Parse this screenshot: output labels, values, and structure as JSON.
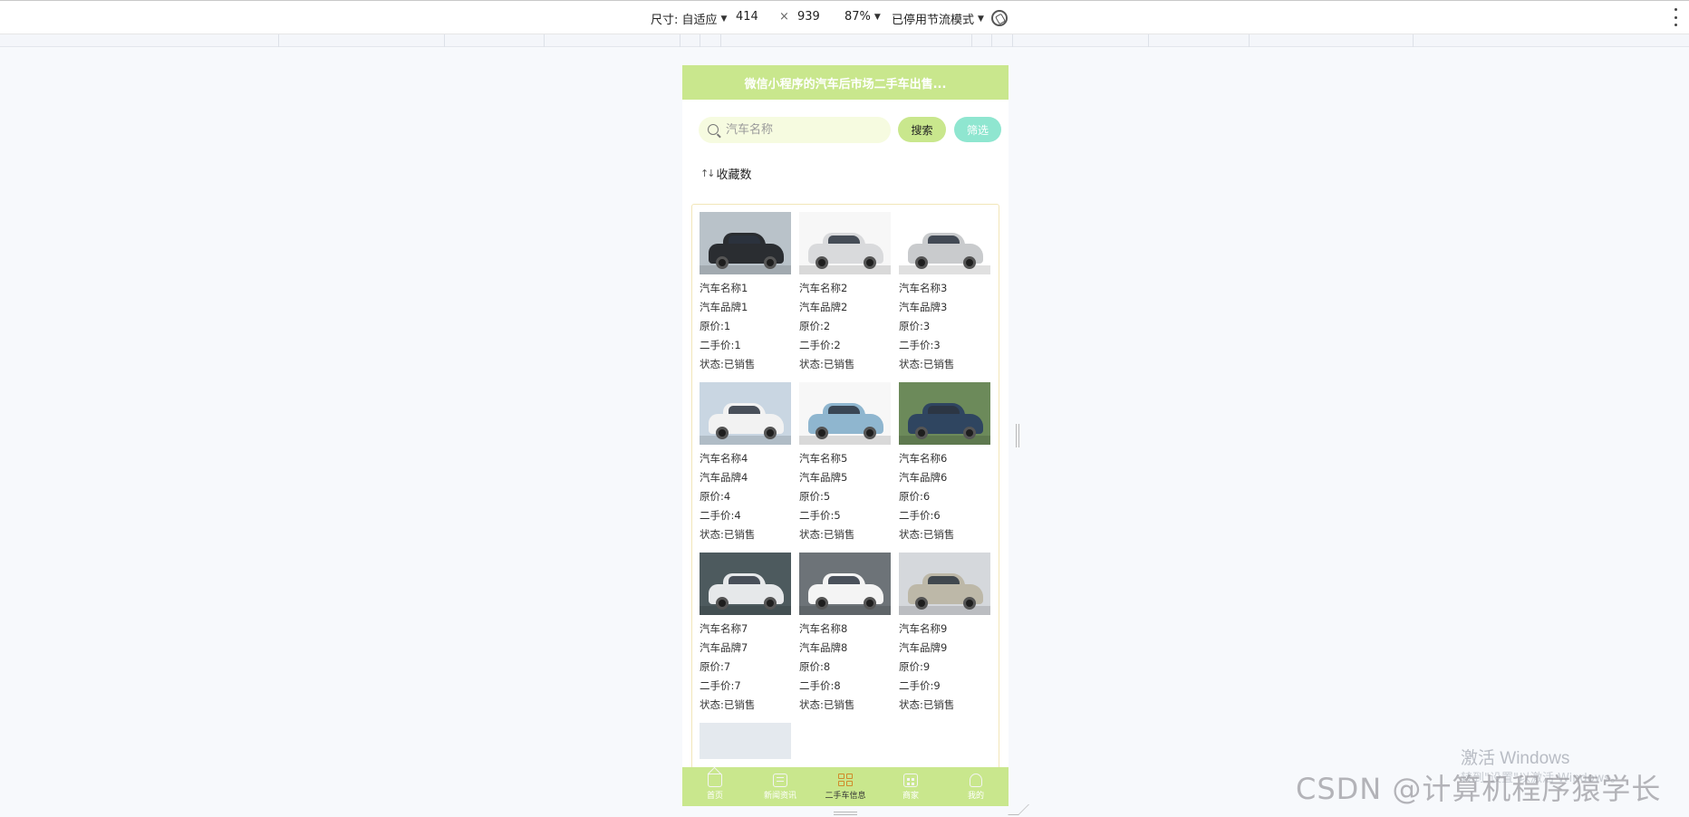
{
  "devtools": {
    "size_label": "尺寸: 自适应",
    "width": "414",
    "times": "×",
    "height": "939",
    "zoom": "87%",
    "throttle": "已停用节流模式"
  },
  "app": {
    "title": "微信小程序的汽车后市场二手车出售...",
    "search": {
      "placeholder": "汽车名称",
      "search_button": "搜索",
      "filter_button": "筛选"
    },
    "sort_label": "收藏数",
    "cars": [
      {
        "name": "汽车名称1",
        "brand": "汽车品牌1",
        "original_price": "原价:1",
        "used_price": "二手价:1",
        "status": "状态:已销售",
        "color": "#2a2d31",
        "bg": "#b9c2c9"
      },
      {
        "name": "汽车名称2",
        "brand": "汽车品牌2",
        "original_price": "原价:2",
        "used_price": "二手价:2",
        "status": "状态:已销售",
        "color": "#d9dadc",
        "bg": "#f7f7f7"
      },
      {
        "name": "汽车名称3",
        "brand": "汽车品牌3",
        "original_price": "原价:3",
        "used_price": "二手价:3",
        "status": "状态:已销售",
        "color": "#c9cbcd",
        "bg": "#ffffff"
      },
      {
        "name": "汽车名称4",
        "brand": "汽车品牌4",
        "original_price": "原价:4",
        "used_price": "二手价:4",
        "status": "状态:已销售",
        "color": "#f2f2f2",
        "bg": "#c9d6e2"
      },
      {
        "name": "汽车名称5",
        "brand": "汽车品牌5",
        "original_price": "原价:5",
        "used_price": "二手价:5",
        "status": "状态:已销售",
        "color": "#8fb6cf",
        "bg": "#f7f7f7"
      },
      {
        "name": "汽车名称6",
        "brand": "汽车品牌6",
        "original_price": "原价:6",
        "used_price": "二手价:6",
        "status": "状态:已销售",
        "color": "#2f4560",
        "bg": "#6c8a5a"
      },
      {
        "name": "汽车名称7",
        "brand": "汽车品牌7",
        "original_price": "原价:7",
        "used_price": "二手价:7",
        "status": "状态:已销售",
        "color": "#e6e8ea",
        "bg": "#4d5a5e"
      },
      {
        "name": "汽车名称8",
        "brand": "汽车品牌8",
        "original_price": "原价:8",
        "used_price": "二手价:8",
        "status": "状态:已销售",
        "color": "#f4f4f4",
        "bg": "#6d7378"
      },
      {
        "name": "汽车名称9",
        "brand": "汽车品牌9",
        "original_price": "原价:9",
        "used_price": "二手价:9",
        "status": "状态:已销售",
        "color": "#bdb8a8",
        "bg": "#d5d8dc"
      }
    ],
    "tabs": [
      {
        "label": "首页",
        "icon": "home-icon"
      },
      {
        "label": "新闻资讯",
        "icon": "news-icon"
      },
      {
        "label": "二手车信息",
        "icon": "grid-icon"
      },
      {
        "label": "商家",
        "icon": "shop-icon"
      },
      {
        "label": "我的",
        "icon": "user-icon"
      }
    ]
  },
  "watermarks": {
    "windows": "激活 Windows",
    "windows_sub": "转到\"设置\"以激活 Windows。",
    "csdn": "CSDN @计算机程序猿学长"
  },
  "colors": {
    "header_green": "#c9e78d",
    "filter_teal": "#8fe6d0"
  }
}
